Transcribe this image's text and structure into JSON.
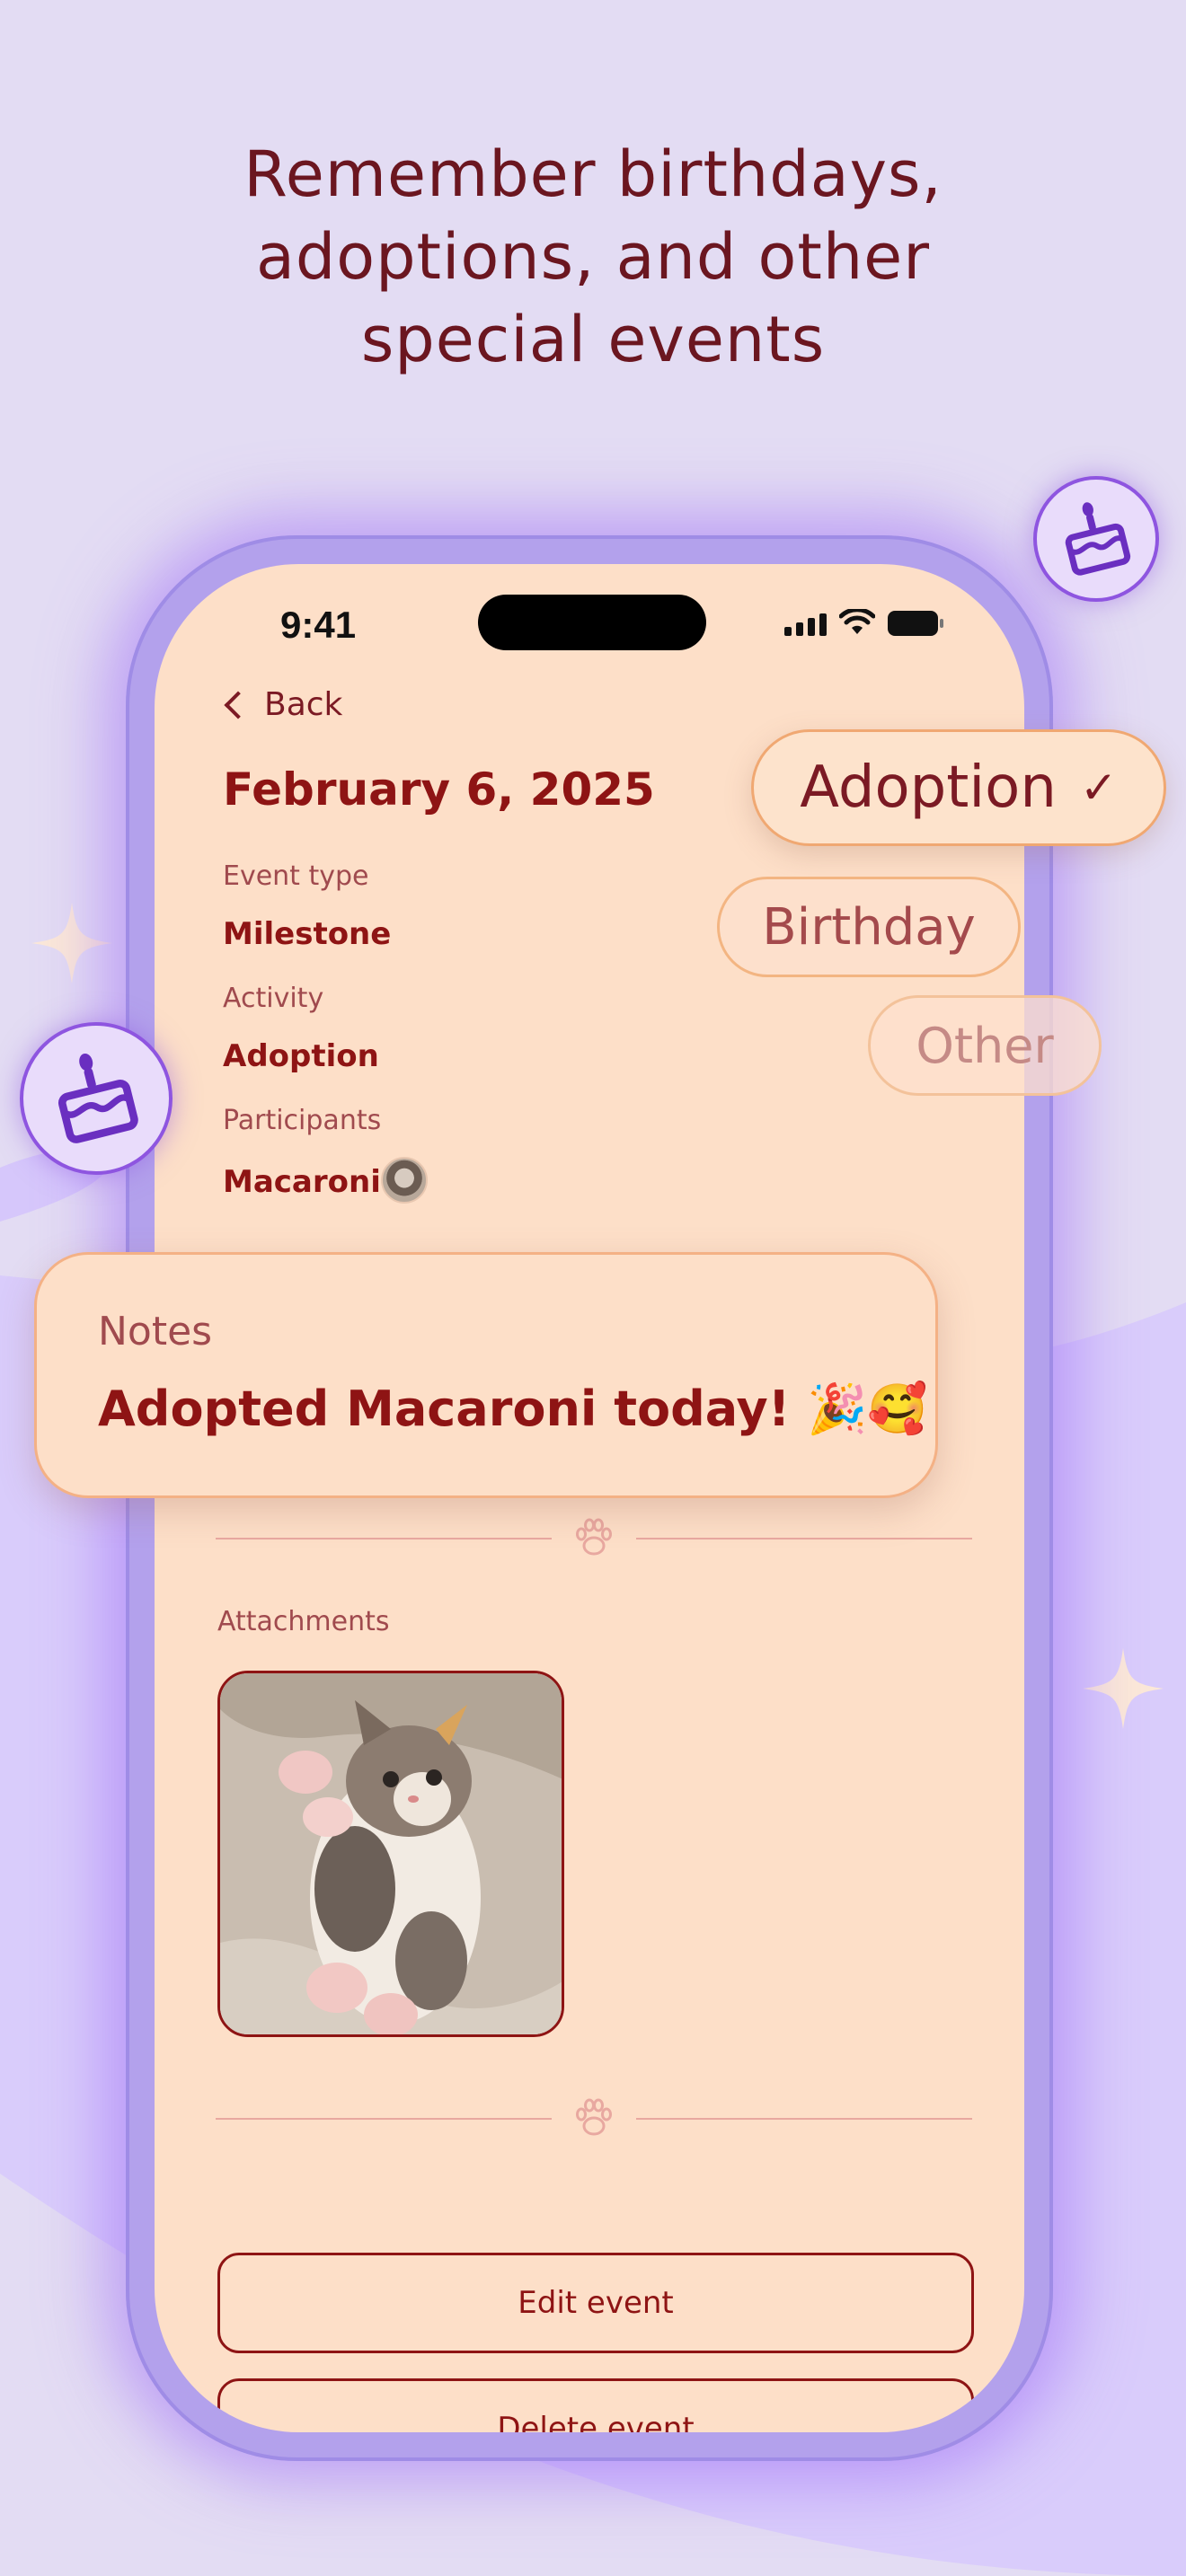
{
  "headline": [
    "Remember birthdays,",
    "adoptions, and other",
    "special events"
  ],
  "status_bar": {
    "time": "9:41"
  },
  "nav": {
    "back_label": "Back"
  },
  "event": {
    "date": "February 6, 2025",
    "event_type_label": "Event type",
    "event_type_value": "Milestone",
    "activity_label": "Activity",
    "activity_value": "Adoption",
    "participants_label": "Participants",
    "participants_value": "Macaroni"
  },
  "options": {
    "adoption": "Adoption",
    "adoption_check": "✓",
    "birthday": "Birthday",
    "other": "Other"
  },
  "notes": {
    "label": "Notes",
    "text": "Adopted Macaroni today! 🎉🥰"
  },
  "attachments": {
    "label": "Attachments"
  },
  "buttons": {
    "edit": "Edit event",
    "delete": "Delete event"
  },
  "colors": {
    "background": "#e3dcf3",
    "screen": "#fddfc8",
    "accent_text": "#8e1414",
    "phone_frame": "#b3a1ec",
    "badge_purple": "#6a2fc0"
  }
}
